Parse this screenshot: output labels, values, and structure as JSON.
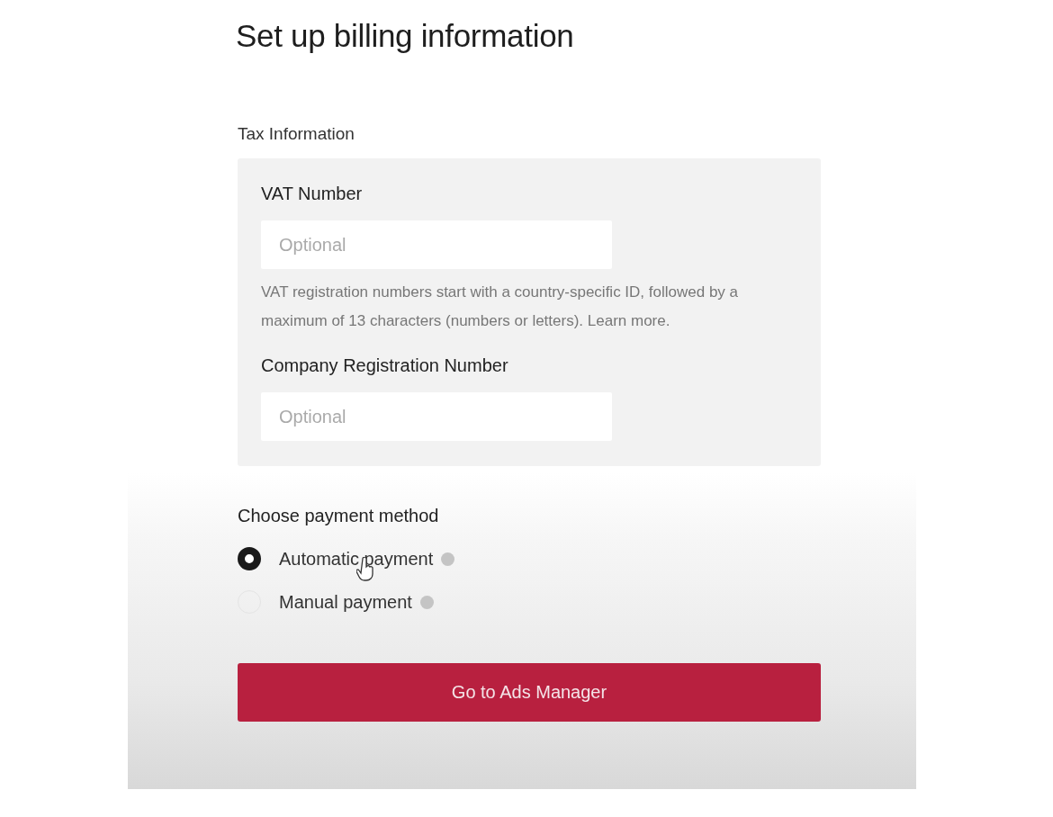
{
  "title": "Set up billing information",
  "tax_section": {
    "label": "Tax Information",
    "fields": [
      {
        "label": "VAT Number",
        "placeholder": "Optional",
        "help": "VAT registration numbers start with a country-specific ID, followed by a maximum of 13 characters (numbers or letters).",
        "help_link": "Learn more."
      },
      {
        "label": "Company Registration Number",
        "placeholder": "Optional"
      }
    ]
  },
  "payment": {
    "label": "Choose payment method",
    "options": [
      {
        "label": "Automatic payment",
        "selected": true
      },
      {
        "label": "Manual payment",
        "selected": false
      }
    ]
  },
  "submit_button": "Go to Ads Manager"
}
